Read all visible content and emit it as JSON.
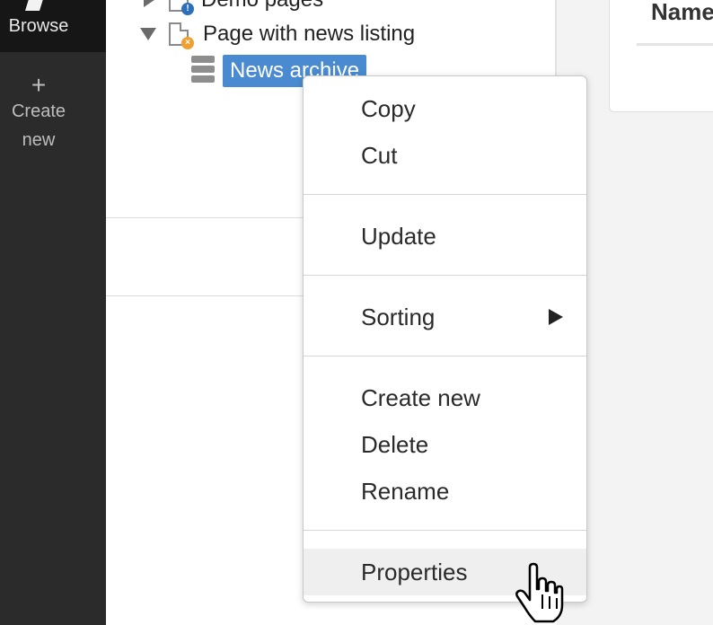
{
  "sidebar": {
    "browse_label": "Browse",
    "browse_icon": "pencil-icon",
    "create_plus": "+",
    "create_label_line1": "Create",
    "create_label_line2": "new"
  },
  "tree": {
    "items": [
      {
        "label": "Demo pages",
        "icon": "page-info-icon",
        "state": "collapsed"
      },
      {
        "label": "Page with news listing",
        "icon": "page-news-icon",
        "state": "expanded"
      },
      {
        "label": "News archive",
        "icon": "folder-archive-icon",
        "state": "selected"
      }
    ]
  },
  "right_panel": {
    "column_header": "Name"
  },
  "context_menu": {
    "items": [
      {
        "label": "Copy"
      },
      {
        "label": "Cut"
      },
      {
        "label": "Update"
      },
      {
        "label": "Sorting",
        "submenu": true
      },
      {
        "label": "Create new"
      },
      {
        "label": "Delete"
      },
      {
        "label": "Rename"
      },
      {
        "label": "Properties",
        "hovered": true
      }
    ]
  },
  "colors": {
    "sidebar_bg": "#2b2b2b",
    "selection_bg": "#4a8ad0",
    "hover_bg": "#efefef"
  }
}
